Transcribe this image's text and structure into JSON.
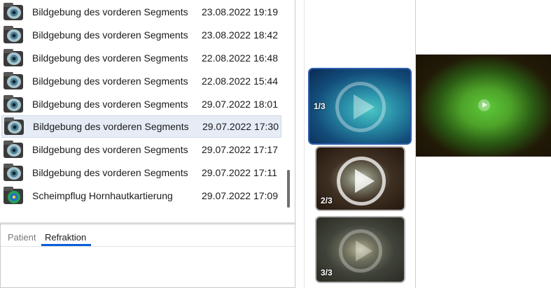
{
  "exam_list": {
    "items": [
      {
        "name": "Bildgebung des vorderen Segments",
        "date": "23.08.2022 19:19",
        "icon": "anterior-segment-icon",
        "selected": false
      },
      {
        "name": "Bildgebung des vorderen Segments",
        "date": "23.08.2022 18:42",
        "icon": "anterior-segment-icon",
        "selected": false
      },
      {
        "name": "Bildgebung des vorderen Segments",
        "date": "22.08.2022 16:48",
        "icon": "anterior-segment-icon",
        "selected": false
      },
      {
        "name": "Bildgebung des vorderen Segments",
        "date": "22.08.2022 15:44",
        "icon": "anterior-segment-icon",
        "selected": false
      },
      {
        "name": "Bildgebung des vorderen Segments",
        "date": "29.07.2022 18:01",
        "icon": "anterior-segment-icon",
        "selected": false
      },
      {
        "name": "Bildgebung des vorderen Segments",
        "date": "29.07.2022 17:30",
        "icon": "anterior-segment-icon",
        "selected": true
      },
      {
        "name": "Bildgebung des vorderen Segments",
        "date": "29.07.2022 17:17",
        "icon": "anterior-segment-icon",
        "selected": false
      },
      {
        "name": "Bildgebung des vorderen Segments",
        "date": "29.07.2022 17:11",
        "icon": "anterior-segment-icon",
        "selected": false
      },
      {
        "name": "Scheimpflug Hornhautkartierung",
        "date": "29.07.2022 17:09",
        "icon": "scheimpflug-icon",
        "selected": false
      }
    ]
  },
  "tabs": [
    {
      "label": "Patient",
      "active": false
    },
    {
      "label": "Refraktion",
      "active": true
    }
  ],
  "thumbnails": [
    {
      "label": "1/3",
      "selected": true
    },
    {
      "label": "2/3",
      "selected": false
    },
    {
      "label": "3/3",
      "selected": false
    }
  ],
  "colors": {
    "selection_row": "#e5ecf6",
    "tab_accent": "#0a5fd7",
    "thumb_selected_border": "#2d5fae"
  }
}
